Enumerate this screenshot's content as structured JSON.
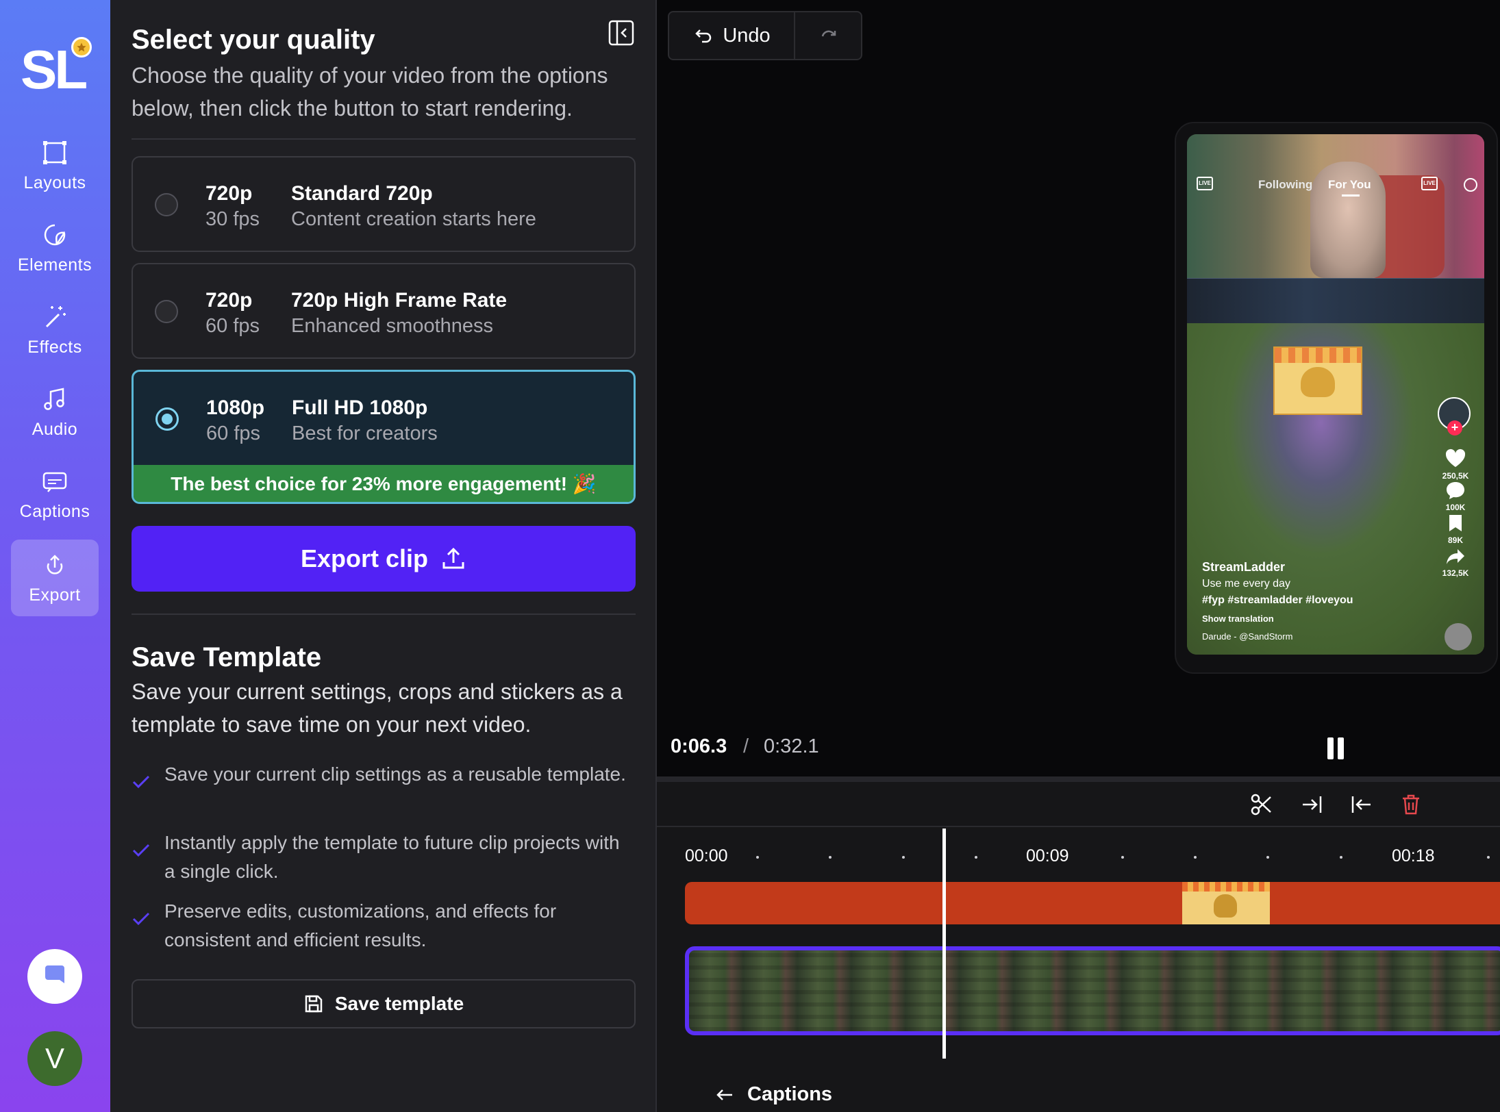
{
  "sidebar": {
    "logo": "SL",
    "items": [
      {
        "label": "Layouts",
        "icon": "square-icon"
      },
      {
        "label": "Elements",
        "icon": "sticker-icon"
      },
      {
        "label": "Effects",
        "icon": "magic-wand-icon"
      },
      {
        "label": "Audio",
        "icon": "music-note-icon"
      },
      {
        "label": "Captions",
        "icon": "captions-icon"
      },
      {
        "label": "Export",
        "icon": "export-icon",
        "active": true
      }
    ],
    "avatar_initial": "V"
  },
  "quality": {
    "title": "Select your quality",
    "subtitle": "Choose the quality of your video from the options below, then click the button to start rendering.",
    "options": [
      {
        "res": "720p",
        "fps": "30 fps",
        "name": "Standard 720p",
        "desc": "Content creation starts here",
        "selected": false
      },
      {
        "res": "720p",
        "fps": "60 fps",
        "name": "720p High Frame Rate",
        "desc": "Enhanced smoothness",
        "selected": false
      },
      {
        "res": "1080p",
        "fps": "60 fps",
        "name": "Full HD 1080p",
        "desc": "Best for creators",
        "selected": true,
        "badge": "The best choice for 23% more engagement! 🎉"
      }
    ],
    "export_label": "Export clip"
  },
  "template": {
    "title": "Save Template",
    "subtitle": "Save your current settings, crops and stickers as a template to save time on your next video.",
    "benefits": [
      "Save your current clip settings as a reusable template.",
      "Instantly apply the template to future clip projects with a single click.",
      "Preserve edits, customizations, and effects for consistent and efficient results."
    ],
    "save_label": "Save template"
  },
  "editor": {
    "undo_label": "Undo",
    "time_current": "0:06.3",
    "time_separator": "/",
    "time_total": "0:32.1",
    "playhead_fraction": 0.196,
    "ruler": [
      "00:00",
      "00:09",
      "00:18"
    ],
    "captions_back": "Captions"
  },
  "preview": {
    "tab_following": "Following",
    "tab_foryou": "For You",
    "live": "LIVE",
    "likes": "250,5K",
    "comments": "100K",
    "saves": "89K",
    "shares": "132,5K",
    "username": "StreamLadder",
    "description": "Use me every day",
    "hashtags": "#fyp #streamladder #loveyou",
    "translation": "Show translation",
    "music": "Darude - @SandStorm"
  },
  "colors": {
    "accent": "#5222f5",
    "selected_border": "#5ab8d8",
    "badge_green": "#2f8a42",
    "clip_red": "#c23a1a"
  }
}
